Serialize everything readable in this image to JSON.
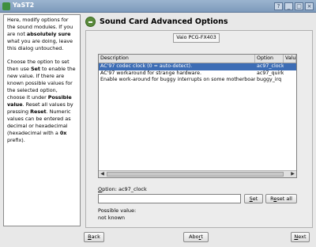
{
  "window": {
    "title": "YaST2"
  },
  "help": {
    "p1_a": "Here, modify options for the sound modules. If you are not",
    "p1_b": "absolutely sure",
    "p1_c": "what you are doing, leave this dialog untouched.",
    "p2_a": "Choose the option to set then use",
    "p2_b": "Set",
    "p2_c": "to enable the new value. If there are known possible values for the selected option, choose it under",
    "p2_d": "Possible value",
    "p2_e": ". Reset all values by pressing",
    "p2_f": "Reset",
    "p2_g": ". Numeric values can be entered as decimal or hexadecimal (hexadecimal with a",
    "p2_h": "0x",
    "p2_i": "prefix)."
  },
  "header": {
    "title": "Sound Card Advanced Options",
    "icon": "sound-card-icon"
  },
  "device_tab": "Vaio PCG-FX403",
  "table": {
    "columns": [
      "Description",
      "Option",
      "Value"
    ],
    "rows": [
      {
        "description": "AC'97 codec clock (0 = auto-detect).",
        "option": "ac97_clock",
        "value": ""
      },
      {
        "description": "AC'97 workaround for strange hardware.",
        "option": "ac97_quirk",
        "value": ""
      },
      {
        "description": "Enable work-around for buggy interrupts on some motherboards.",
        "option": "buggy_irq",
        "value": ""
      }
    ]
  },
  "option": {
    "label_u": "O",
    "label_rest": "ption:",
    "value": "ac97_clock"
  },
  "value_input": {
    "value": ""
  },
  "buttons": {
    "set_u": "S",
    "set_rest": "et",
    "reset_a": "R",
    "reset_u": "e",
    "reset_rest": "set all",
    "back_u": "B",
    "back_rest": "ack",
    "abort_a": "Abo",
    "abort_u": "r",
    "abort_rest": "t",
    "next_u": "N",
    "next_rest": "ext"
  },
  "possible": {
    "label": "Possible value:",
    "value": "not known"
  },
  "colors": {
    "titlebar": "#8aa6c6",
    "selection": "#3d6db5",
    "header_icon": "#5a8a3c"
  }
}
